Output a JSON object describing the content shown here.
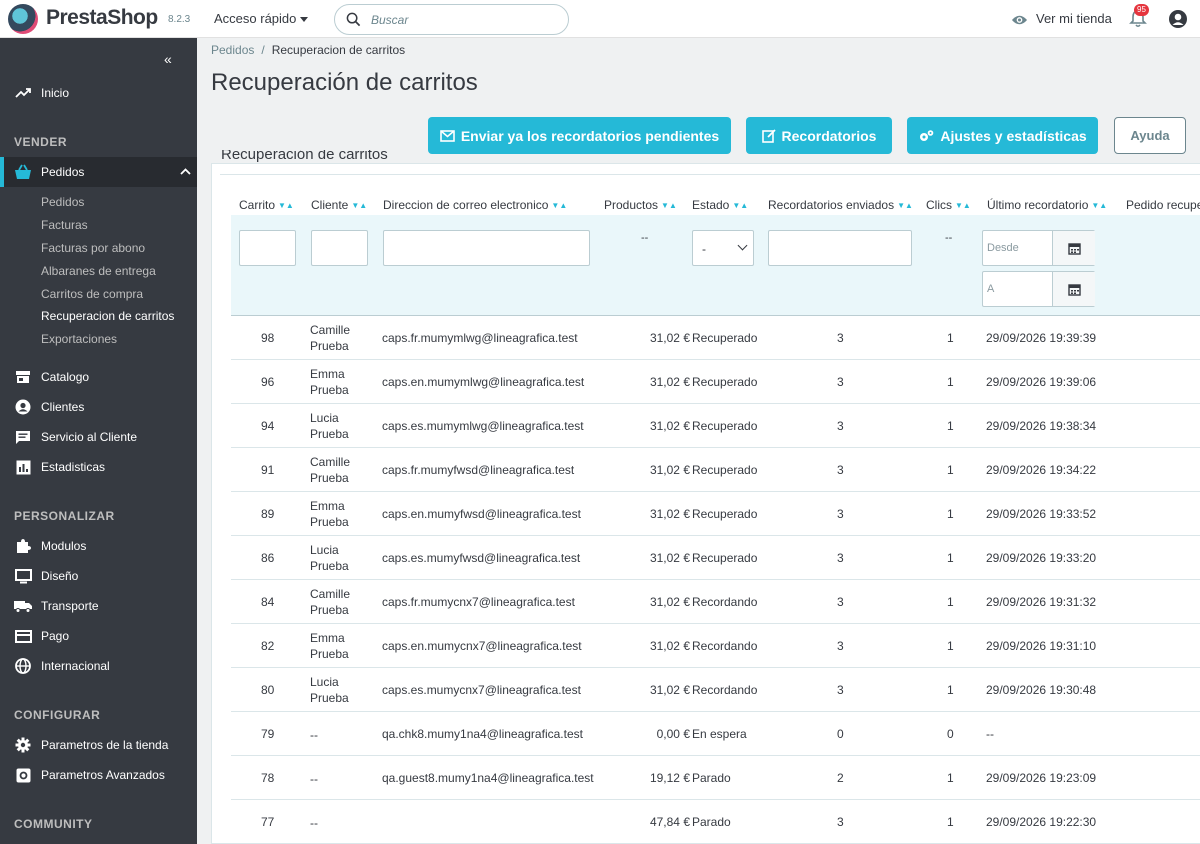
{
  "topbar": {
    "brand": "PrestaShop",
    "version": "8.2.3",
    "quick_access": "Acceso rápido",
    "search_placeholder": "Buscar",
    "view_shop": "Ver mi tienda",
    "notifications": "95"
  },
  "sidebar": {
    "collapse": "«",
    "home": "Inicio",
    "sec_vender": "VENDER",
    "pedidos": "Pedidos",
    "submenu": [
      "Pedidos",
      "Facturas",
      "Facturas por abono",
      "Albaranes de entrega",
      "Carritos de compra",
      "Recuperacion de carritos",
      "Exportaciones"
    ],
    "catalogo": "Catalogo",
    "clientes": "Clientes",
    "servicio": "Servicio al Cliente",
    "estadisticas": "Estadisticas",
    "sec_personalizar": "PERSONALIZAR",
    "modulos": "Modulos",
    "diseno": "Diseño",
    "transporte": "Transporte",
    "pago": "Pago",
    "internacional": "Internacional",
    "sec_configurar": "CONFIGURAR",
    "parametros_tienda": "Parametros de la tienda",
    "parametros_avanzados": "Parametros Avanzados",
    "sec_community": "COMMUNITY"
  },
  "breadcrumb": {
    "parent": "Pedidos",
    "sep": "/",
    "current": "Recuperacion de carritos"
  },
  "page_title": "Recuperación de carritos",
  "toolbar": {
    "send_reminders": "Enviar ya los recordatorios pendientes",
    "reminders": "Recordatorios",
    "settings": "Ajustes y estadísticas",
    "help": "Ayuda"
  },
  "panel_title": "Recuperación de carritos",
  "columns": [
    "Carrito",
    "Cliente",
    "Direccion de correo electronico",
    "Productos",
    "Estado",
    "Recordatorios enviados",
    "Clics",
    "Último recordatorio",
    "Pedido recupe"
  ],
  "filters": {
    "productos": "--",
    "estado": "-",
    "clics": "--",
    "desde": "Desde",
    "hasta": "A"
  },
  "rows": [
    {
      "id": "98",
      "cliente": [
        "Camille",
        "Prueba"
      ],
      "email": "caps.fr.mumymlwg@lineagrafica.test",
      "productos": "31,02 €",
      "estado": "Recuperado",
      "enviados": "3",
      "clics": "1",
      "ultimo": "29/09/2026 19:39:39"
    },
    {
      "id": "96",
      "cliente": [
        "Emma",
        "Prueba"
      ],
      "email": "caps.en.mumymlwg@lineagrafica.test",
      "productos": "31,02 €",
      "estado": "Recuperado",
      "enviados": "3",
      "clics": "1",
      "ultimo": "29/09/2026 19:39:06"
    },
    {
      "id": "94",
      "cliente": [
        "Lucia",
        "Prueba"
      ],
      "email": "caps.es.mumymlwg@lineagrafica.test",
      "productos": "31,02 €",
      "estado": "Recuperado",
      "enviados": "3",
      "clics": "1",
      "ultimo": "29/09/2026 19:38:34"
    },
    {
      "id": "91",
      "cliente": [
        "Camille",
        "Prueba"
      ],
      "email": "caps.fr.mumyfwsd@lineagrafica.test",
      "productos": "31,02 €",
      "estado": "Recuperado",
      "enviados": "3",
      "clics": "1",
      "ultimo": "29/09/2026 19:34:22"
    },
    {
      "id": "89",
      "cliente": [
        "Emma",
        "Prueba"
      ],
      "email": "caps.en.mumyfwsd@lineagrafica.test",
      "productos": "31,02 €",
      "estado": "Recuperado",
      "enviados": "3",
      "clics": "1",
      "ultimo": "29/09/2026 19:33:52"
    },
    {
      "id": "86",
      "cliente": [
        "Lucia",
        "Prueba"
      ],
      "email": "caps.es.mumyfwsd@lineagrafica.test",
      "productos": "31,02 €",
      "estado": "Recuperado",
      "enviados": "3",
      "clics": "1",
      "ultimo": "29/09/2026 19:33:20"
    },
    {
      "id": "84",
      "cliente": [
        "Camille",
        "Prueba"
      ],
      "email": "caps.fr.mumycnx7@lineagrafica.test",
      "productos": "31,02 €",
      "estado": "Recordando",
      "enviados": "3",
      "clics": "1",
      "ultimo": "29/09/2026 19:31:32"
    },
    {
      "id": "82",
      "cliente": [
        "Emma",
        "Prueba"
      ],
      "email": "caps.en.mumycnx7@lineagrafica.test",
      "productos": "31,02 €",
      "estado": "Recordando",
      "enviados": "3",
      "clics": "1",
      "ultimo": "29/09/2026 19:31:10"
    },
    {
      "id": "80",
      "cliente": [
        "Lucia",
        "Prueba"
      ],
      "email": "caps.es.mumycnx7@lineagrafica.test",
      "productos": "31,02 €",
      "estado": "Recordando",
      "enviados": "3",
      "clics": "1",
      "ultimo": "29/09/2026 19:30:48"
    },
    {
      "id": "79",
      "cliente": [
        "--",
        ""
      ],
      "email": "qa.chk8.mumy1na4@lineagrafica.test",
      "productos": "0,00 €",
      "estado": "En espera",
      "enviados": "0",
      "clics": "0",
      "ultimo": "--"
    },
    {
      "id": "78",
      "cliente": [
        "--",
        ""
      ],
      "email": "qa.guest8.mumy1na4@lineagrafica.test",
      "productos": "19,12 €",
      "estado": "Parado",
      "enviados": "2",
      "clics": "1",
      "ultimo": "29/09/2026 19:23:09"
    },
    {
      "id": "77",
      "cliente": [
        "--",
        ""
      ],
      "email": "",
      "productos": "47,84 €",
      "estado": "Parado",
      "enviados": "3",
      "clics": "1",
      "ultimo": "29/09/2026 19:22:30"
    }
  ],
  "colors": {
    "accent": "#25b9d7",
    "sidebar": "#363a41",
    "badge": "#e5353e"
  }
}
